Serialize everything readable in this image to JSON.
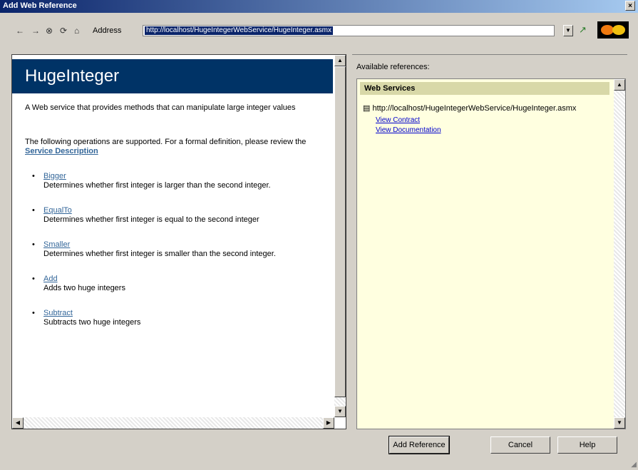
{
  "window": {
    "title": "Add Web Reference",
    "close_glyph": "×"
  },
  "toolbar": {
    "back": "←",
    "forward": "→",
    "stop": "⊗",
    "refresh": "⟳",
    "home": "⌂",
    "address_label": "Address",
    "address_value": "http://localhost/HugeIntegerWebService/HugeInteger.asmx",
    "go_glyph": "↗"
  },
  "page": {
    "title": "HugeInteger",
    "description": "A Web service that provides methods that can manipulate large integer values",
    "ops_intro": "The following operations are supported. For a formal definition, please review the",
    "service_description_link": "Service Description",
    "operations": [
      {
        "name": "Bigger",
        "desc": "Determines whether first integer is larger than the second integer."
      },
      {
        "name": "EqualTo",
        "desc": "Determines whether first integer is equal to the second integer"
      },
      {
        "name": "Smaller",
        "desc": "Determines whether first integer is smaller than the second integer."
      },
      {
        "name": "Add",
        "desc": "Adds two huge integers"
      },
      {
        "name": "Subtract",
        "desc": "Subtracts two huge integers"
      }
    ]
  },
  "right": {
    "group_label": "Available references:",
    "header": "Web Services",
    "found_text": "http://localhost/HugeIntegerWebService/HugeInteger.asmx",
    "link_contract": "View Contract",
    "link_documentation": "View Documentation"
  },
  "buttons": {
    "add_reference": "Add Reference",
    "cancel": "Cancel",
    "help": "Help"
  }
}
